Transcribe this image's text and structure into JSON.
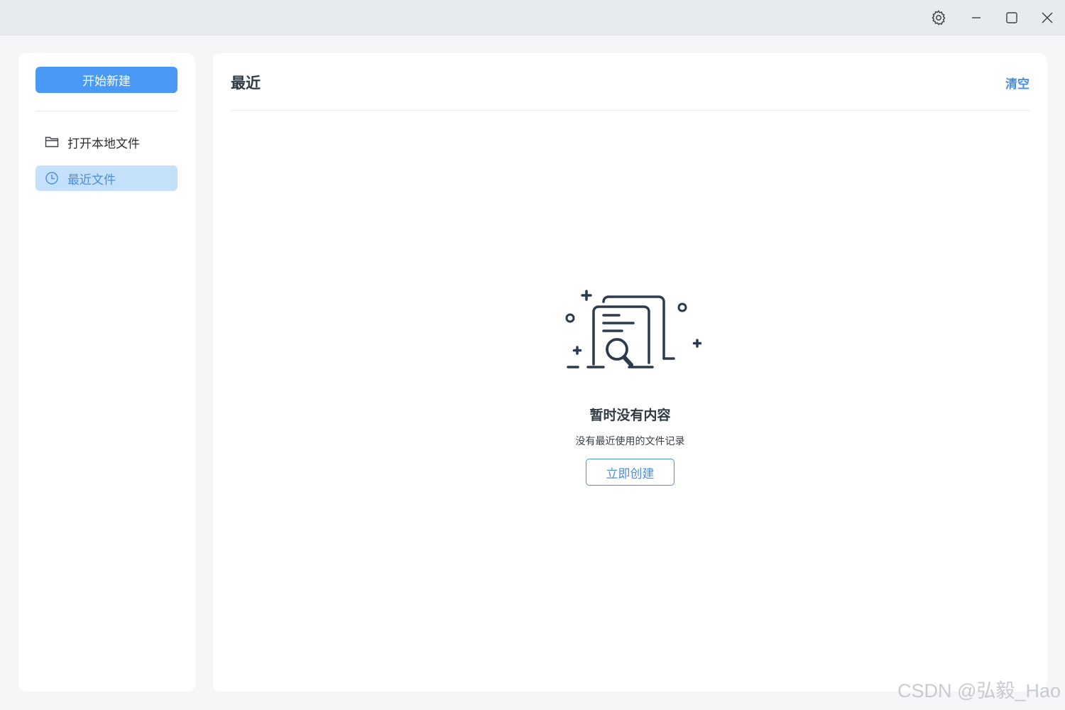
{
  "window": {
    "icons": {
      "settings": "gear-icon",
      "minimize": "minimize-icon",
      "maximize": "maximize-icon",
      "close": "close-icon"
    }
  },
  "sidebar": {
    "new_button_label": "开始新建",
    "items": [
      {
        "label": "打开本地文件",
        "icon": "folder-icon",
        "active": false
      },
      {
        "label": "最近文件",
        "icon": "clock-icon",
        "active": true
      }
    ]
  },
  "main": {
    "title": "最近",
    "clear_label": "清空",
    "empty_state": {
      "illustration": "document-search-icon",
      "title": "暂时没有内容",
      "description": "没有最近使用的文件记录",
      "button_label": "立即创建"
    }
  },
  "watermark": "CSDN @弘毅_Hao",
  "colors": {
    "accent": "#4a9af5",
    "link": "#4a8fdb",
    "active_bg": "#c4e0fb",
    "titlebar_bg": "#e8ebee"
  }
}
